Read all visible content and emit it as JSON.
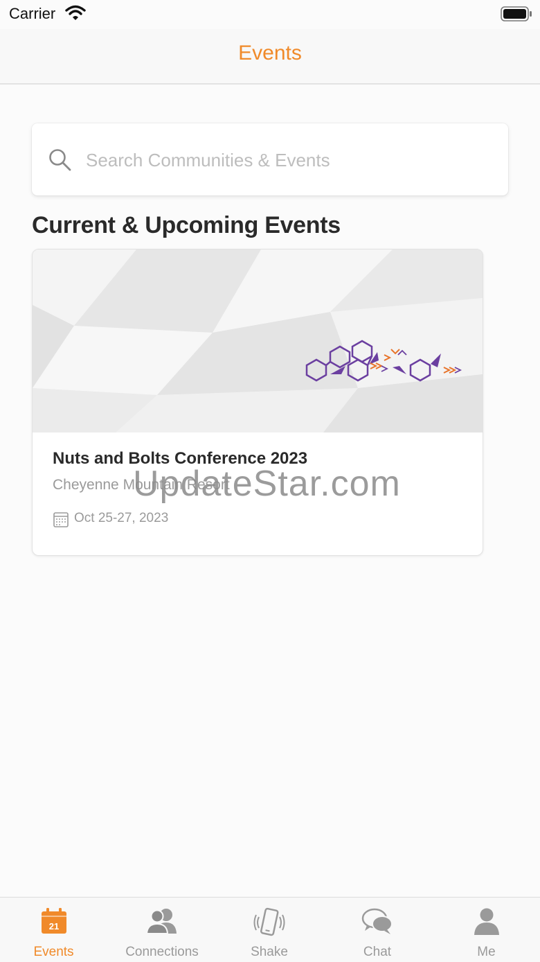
{
  "status_bar": {
    "carrier": "Carrier"
  },
  "nav": {
    "title": "Events"
  },
  "search": {
    "placeholder": "Search Communities & Events"
  },
  "section": {
    "title": "Current & Upcoming Events"
  },
  "events": [
    {
      "name": "Nuts and Bolts Conference 2023",
      "venue": "Cheyenne Mountain Resort",
      "dates": "Oct 25-27, 2023"
    }
  ],
  "watermark": "UpdateStar.com",
  "tabs": [
    {
      "label": "Events",
      "icon": "calendar-icon",
      "badge": "21",
      "active": true
    },
    {
      "label": "Connections",
      "icon": "people-icon",
      "active": false
    },
    {
      "label": "Shake",
      "icon": "phone-shake-icon",
      "active": false
    },
    {
      "label": "Chat",
      "icon": "chat-bubbles-icon",
      "active": false
    },
    {
      "label": "Me",
      "icon": "person-icon",
      "active": false
    }
  ],
  "colors": {
    "accent": "#f08a2a",
    "inactive": "#9a9a9a",
    "logo_purple": "#6b3fa0"
  }
}
